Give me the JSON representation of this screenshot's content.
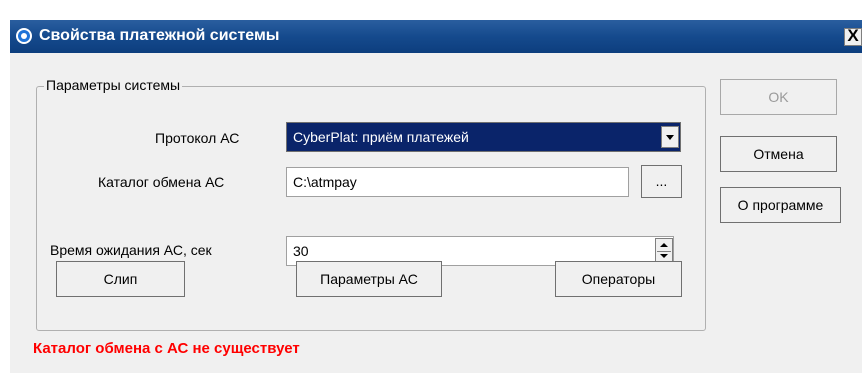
{
  "window": {
    "title": "Свойства платежной системы",
    "close_label": "X"
  },
  "group": {
    "legend": "Параметры системы"
  },
  "protocol": {
    "label": "Протокол АС",
    "value": "CyberPlat: приём платежей"
  },
  "exchange_dir": {
    "label": "Каталог обмена АС",
    "value": "C:\\atmpay",
    "browse_label": "..."
  },
  "timeout": {
    "label": "Время ожидания АС, сек",
    "value": "30"
  },
  "buttons": {
    "slip": "Слип",
    "as_params": "Параметры АС",
    "operators": "Операторы",
    "ok": "OK",
    "cancel": "Отмена",
    "about": "О программе"
  },
  "status": {
    "error": "Каталог обмена с АС не существует"
  },
  "colors": {
    "titlebar": "#154a8d",
    "selected": "#0a246a",
    "error": "#ff0000"
  }
}
